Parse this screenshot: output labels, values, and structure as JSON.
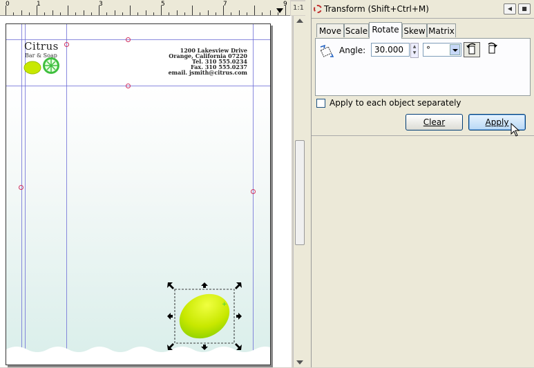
{
  "ruler": {
    "labels": [
      "0",
      "1",
      "3",
      "5",
      "7",
      "9"
    ]
  },
  "zoom_button": {
    "label": "1:1"
  },
  "letterhead": {
    "company": "Citrus",
    "tagline": "Bar & Soap",
    "address_lines": [
      "1200 Lakesview Drive",
      "Orange, California 07220",
      "Tel. 310 555.0234",
      "Fax. 310 555.0237",
      "email. jsmith@citrus.com"
    ]
  },
  "dialog": {
    "title": "Transform (Shift+Ctrl+M)",
    "tabs": [
      {
        "label": "Move",
        "active": false
      },
      {
        "label": "Scale",
        "active": false
      },
      {
        "label": "Rotate",
        "active": true
      },
      {
        "label": "Skew",
        "active": false
      },
      {
        "label": "Matrix",
        "active": false
      }
    ],
    "angle_label": "Angle:",
    "angle_value": "30.000",
    "unit_value": "°",
    "apply_each_label": "Apply to each object separately",
    "apply_each_checked": false,
    "clear_label": "Clear",
    "apply_label": "Apply"
  },
  "colors": {
    "guide": "#6b6bd6",
    "lemon": "#c8e800",
    "apply_button": "#b9d8f5",
    "page_gradient_bottom": "#d9eeea"
  }
}
